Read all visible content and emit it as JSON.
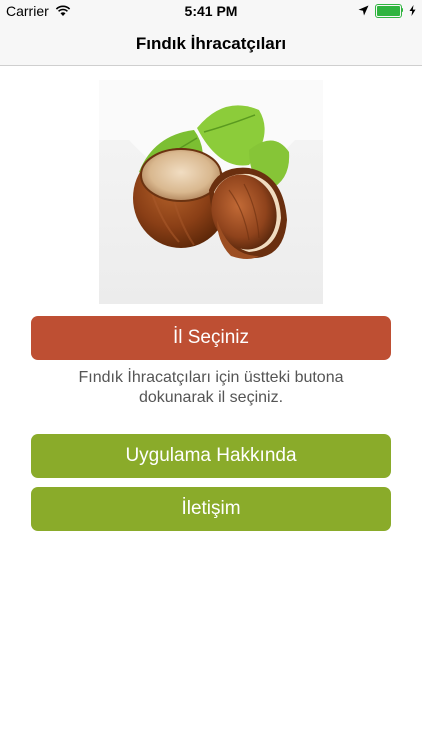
{
  "status_bar": {
    "carrier": "Carrier",
    "time": "5:41 PM",
    "battery_color": "#2fb43f"
  },
  "nav": {
    "title": "Fındık İhracatçıları"
  },
  "hero": {
    "image": "hazelnut-image"
  },
  "buttons": {
    "select_city": "İl Seçiniz",
    "about": "Uygulama Hakkında",
    "contact": "İletişim"
  },
  "hint": "Fındık İhracatçıları için üstteki butona dokunarak il seçiniz.",
  "colors": {
    "primary_button": "#be4f33",
    "secondary_button": "#8aab2a"
  }
}
